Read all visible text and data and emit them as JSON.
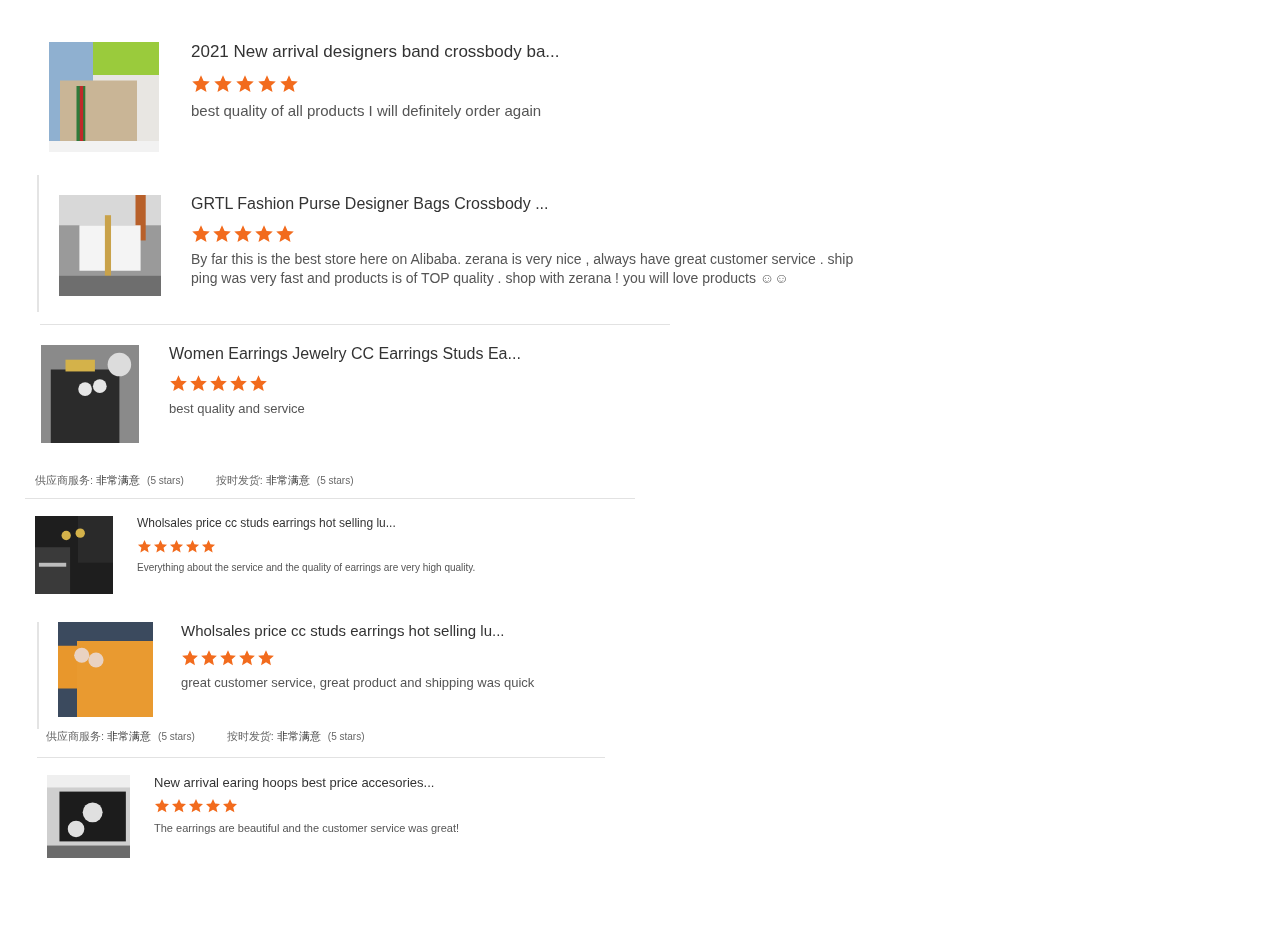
{
  "snippets": [
    {
      "title": "2021 New arrival designers band crossbody ba...",
      "stars": 5,
      "review": "best quality of all products I will definitely order again"
    },
    {
      "title": "GRTL Fashion Purse Designer Bags Crossbody ...",
      "stars": 5,
      "review": "By far this is the best store here on Alibaba.  zerana is very nice ,  always have great customer service . ship ping was very fast and products is of TOP quality . shop with zerana !  you will love products ☺☺"
    },
    {
      "title": "Women Earrings Jewelry CC Earrings Studs Ea...",
      "stars": 5,
      "review": "best quality and service",
      "ratings": [
        {
          "label": "供应商服务:",
          "value": "非常满意",
          "note": "(5 stars)"
        },
        {
          "label": "按时发货:",
          "value": "非常满意",
          "note": "(5 stars)"
        }
      ]
    },
    {
      "title": "Wholsales price cc studs earrings hot selling lu...",
      "stars": 5,
      "review": "Everything about the service and the quality of earrings are very high quality."
    },
    {
      "title": "Wholsales price cc studs earrings hot selling lu...",
      "stars": 5,
      "review": "great customer service, great product and shipping was quick",
      "ratings": [
        {
          "label": "供应商服务:",
          "value": "非常满意",
          "note": "(5 stars)"
        },
        {
          "label": "按时发货:",
          "value": "非常满意",
          "note": "(5 stars)"
        }
      ]
    },
    {
      "title": "New arrival earing hoops best price accesories...",
      "stars": 5,
      "review": "The earrings are beautiful and the customer service was great!"
    }
  ]
}
